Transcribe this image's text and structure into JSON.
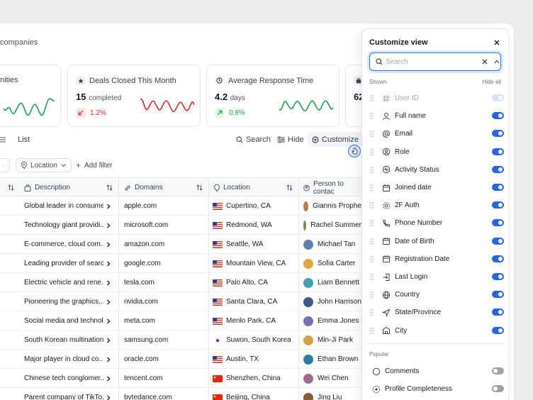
{
  "breadcrumb": "companies",
  "cards": [
    {
      "title": "nities",
      "value": "",
      "unit": "",
      "delta": "",
      "delta_color": "#16a34a"
    },
    {
      "title": "Deals Closed This Month",
      "value": "15",
      "unit": "completed",
      "delta": "1.2%",
      "delta_color": "#dc2626"
    },
    {
      "title": "Average Response Time",
      "value": "4.2",
      "unit": "days",
      "delta": "0.8%",
      "delta_color": "#16a34a"
    },
    {
      "title": "",
      "value": "62",
      "unit": "",
      "delta": "",
      "delta_color": "#16a34a"
    }
  ],
  "toolbar": {
    "list_label": "List",
    "search_label": "Search",
    "hide_label": "Hide",
    "customize_label": "Customize"
  },
  "filters": {
    "location": "Location",
    "add_filter": "Add filter"
  },
  "table": {
    "headers": {
      "description": "Description",
      "domains": "Domains",
      "location": "Location",
      "person": "Person to contac"
    },
    "rows": [
      {
        "description": "Global leader in consume...",
        "domain": "apple.com",
        "location": "Cupertino, CA",
        "flag": "us",
        "person": "Giannis Prophe",
        "avatar": "#c07a4a"
      },
      {
        "description": "Technology giant providi...",
        "domain": "microsoft.com",
        "location": "Redmond, WA",
        "flag": "us",
        "person": "Rachel Summer",
        "avatar": "#6b8f5a"
      },
      {
        "description": "E-commerce, cloud com...",
        "domain": "amazon.com",
        "location": "Seattle, WA",
        "flag": "us",
        "person": "Michael Tan",
        "avatar": "#5a7fb0"
      },
      {
        "description": "Leading provider of searc...",
        "domain": "google.com",
        "location": "Mountain View, CA",
        "flag": "us",
        "person": "Sofia Carter",
        "avatar": "#e0a63c"
      },
      {
        "description": "Electric vehicle and rene...",
        "domain": "tesla.com",
        "location": "Palo Alto, CA",
        "flag": "us",
        "person": "Liam Bennett",
        "avatar": "#3aa3b8"
      },
      {
        "description": "Pioneering the graphics...",
        "domain": "nvidia.com",
        "location": "Santa Clara, CA",
        "flag": "us",
        "person": "John Harrison",
        "avatar": "#3d5a8a"
      },
      {
        "description": "Social media and technol...",
        "domain": "meta.com",
        "location": "Menlo Park, CA",
        "flag": "us",
        "person": "Emma Jones",
        "avatar": "#7a6fb5"
      },
      {
        "description": "South Korean multination...",
        "domain": "samsung.com",
        "location": "Suwon, South Korea",
        "flag": "kr",
        "person": "Min-Ji Park",
        "avatar": "#d8a24a"
      },
      {
        "description": "Major player in cloud co...",
        "domain": "oracle.com",
        "location": "Austin, TX",
        "flag": "us",
        "person": "Ethan Brown",
        "avatar": "#2f7aa8"
      },
      {
        "description": "Chinese tech conglomer...",
        "domain": "tencent.com",
        "location": "Shenzhen, China",
        "flag": "cn",
        "person": "Wei Chen",
        "avatar": "#a46a8c"
      },
      {
        "description": "Parent company of TikTo...",
        "domain": "bytedance.com",
        "location": "Beijing, China",
        "flag": "cn",
        "person": "Jing Liu",
        "avatar": "#8a5a3a"
      }
    ]
  },
  "panel": {
    "title": "Customize view",
    "search_placeholder": "Search",
    "shown_label": "Shown",
    "hide_all_label": "Hide all",
    "popular_label": "Popular",
    "shown_fields": [
      {
        "label": "User ID",
        "icon": "hash-icon",
        "state": "disabled"
      },
      {
        "label": "Full name",
        "icon": "user-icon",
        "state": "on"
      },
      {
        "label": "Email",
        "icon": "at-icon",
        "state": "on"
      },
      {
        "label": "Role",
        "icon": "role-icon",
        "state": "on"
      },
      {
        "label": "Activity Status",
        "icon": "activity-icon",
        "state": "on"
      },
      {
        "label": "Joined date",
        "icon": "calendar-icon",
        "state": "on"
      },
      {
        "label": "2F Auth",
        "icon": "gear-icon",
        "state": "on"
      },
      {
        "label": "Phone Number",
        "icon": "phone-icon",
        "state": "on"
      },
      {
        "label": "Date of Birth",
        "icon": "calendar-icon",
        "state": "on"
      },
      {
        "label": "Registration Date",
        "icon": "calendar-icon",
        "state": "on"
      },
      {
        "label": "Last Login",
        "icon": "login-icon",
        "state": "on"
      },
      {
        "label": "Country",
        "icon": "globe-icon",
        "state": "on"
      },
      {
        "label": "State/Province",
        "icon": "navigation-icon",
        "state": "on"
      },
      {
        "label": "City",
        "icon": "building-icon",
        "state": "on"
      }
    ],
    "popular_fields": [
      {
        "label": "Comments",
        "icon": "comment-icon",
        "state": "off"
      },
      {
        "label": "Profile Completeness",
        "icon": "progress-icon",
        "state": "off"
      }
    ]
  },
  "colors": {
    "accent": "#2563eb",
    "positive": "#16a34a",
    "negative": "#dc2626"
  }
}
